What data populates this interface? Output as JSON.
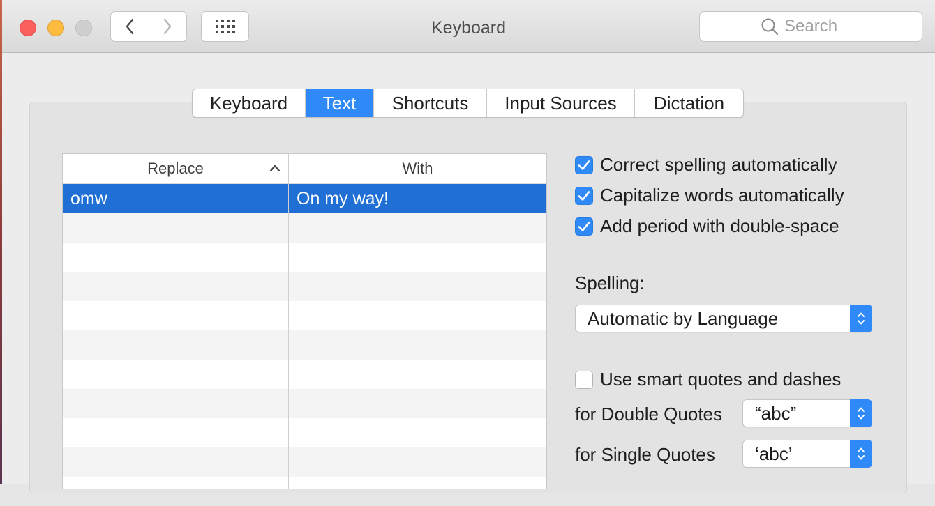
{
  "window": {
    "title": "Keyboard"
  },
  "toolbar": {
    "search_placeholder": "Search"
  },
  "tabs": [
    {
      "label": "Keyboard",
      "active": false
    },
    {
      "label": "Text",
      "active": true
    },
    {
      "label": "Shortcuts",
      "active": false
    },
    {
      "label": "Input Sources",
      "active": false
    },
    {
      "label": "Dictation",
      "active": false
    }
  ],
  "table": {
    "columns": [
      "Replace",
      "With"
    ],
    "sorted_column": "Replace",
    "rows": [
      {
        "replace": "omw",
        "with": "On my way!",
        "selected": true
      }
    ]
  },
  "options": {
    "correct_spelling": {
      "label": "Correct spelling automatically",
      "checked": true
    },
    "capitalize_words": {
      "label": "Capitalize words automatically",
      "checked": true
    },
    "double_space_period": {
      "label": "Add period with double-space",
      "checked": true
    }
  },
  "spelling": {
    "label": "Spelling:",
    "value": "Automatic by Language"
  },
  "smart_quotes": {
    "label": "Use smart quotes and dashes",
    "checked": false,
    "double_label": "for Double Quotes",
    "double_value": "“abc”",
    "single_label": "for Single Quotes",
    "single_value": "‘abc’"
  },
  "colors": {
    "accent": "#2f89f6",
    "selection": "#1f6fd4"
  }
}
